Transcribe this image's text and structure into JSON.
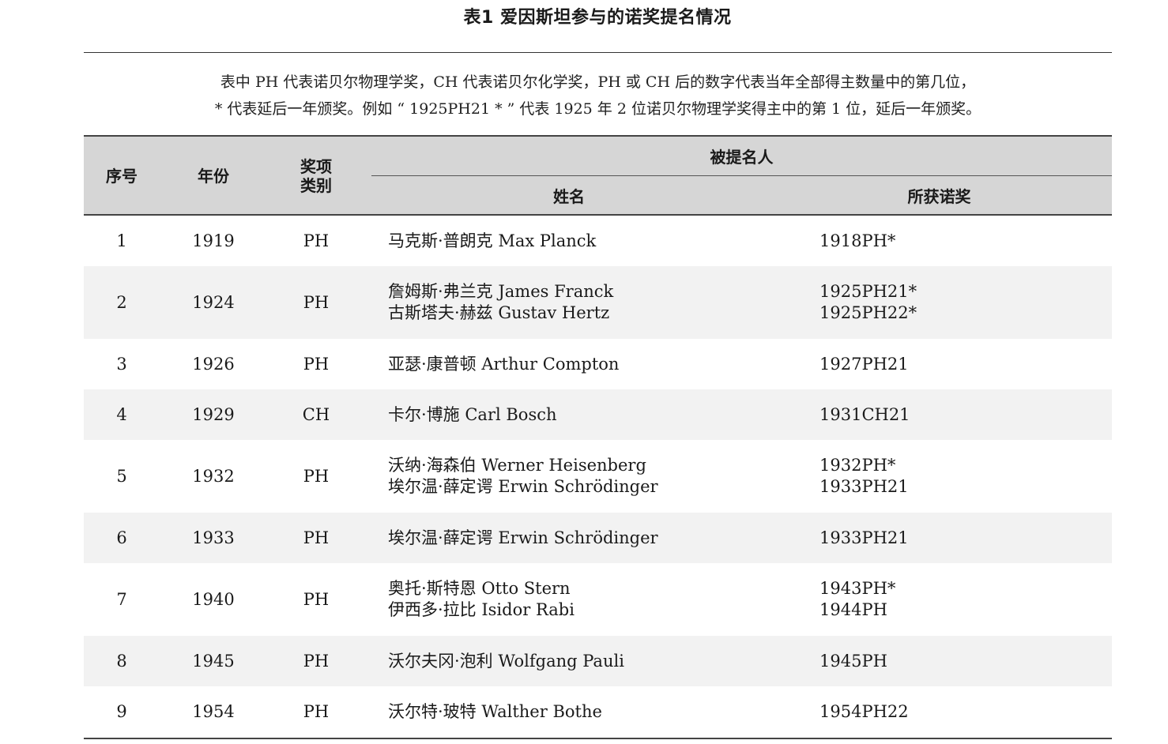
{
  "title": "表1 爱因斯坦参与的诺奖提名情况",
  "note": {
    "line1": "表中 PH 代表诺贝尔物理学奖，CH 代表诺贝尔化学奖，PH 或 CH 后的数字代表当年全部得主数量中的第几位，",
    "line2": "* 代表延后一年颁奖。例如 “ 1925PH21 * ” 代表 1925 年 2 位诺贝尔物理学奖得主中的第 1 位，延后一年颁奖。"
  },
  "headers": {
    "index": "序号",
    "year": "年份",
    "type_line1": "奖项",
    "type_line2": "类别",
    "nominee": "被提名人",
    "name": "姓名",
    "prize": "所获诺奖"
  },
  "rows": [
    {
      "index": "1",
      "year": "1919",
      "type": "PH",
      "names": [
        "马克斯·普朗克 Max Planck"
      ],
      "prizes": [
        "1918PH*"
      ]
    },
    {
      "index": "2",
      "year": "1924",
      "type": "PH",
      "names": [
        "詹姆斯·弗兰克 James Franck",
        "古斯塔夫·赫兹 Gustav Hertz"
      ],
      "prizes": [
        "1925PH21*",
        "1925PH22*"
      ]
    },
    {
      "index": "3",
      "year": "1926",
      "type": "PH",
      "names": [
        "亚瑟·康普顿 Arthur Compton"
      ],
      "prizes": [
        "1927PH21"
      ]
    },
    {
      "index": "4",
      "year": "1929",
      "type": "CH",
      "names": [
        "卡尔·博施 Carl Bosch"
      ],
      "prizes": [
        "1931CH21"
      ]
    },
    {
      "index": "5",
      "year": "1932",
      "type": "PH",
      "names": [
        "沃纳·海森伯 Werner Heisenberg",
        "埃尔温·薛定谔 Erwin Schrödinger"
      ],
      "prizes": [
        "1932PH*",
        "1933PH21"
      ]
    },
    {
      "index": "6",
      "year": "1933",
      "type": "PH",
      "names": [
        "埃尔温·薛定谔 Erwin Schrödinger"
      ],
      "prizes": [
        "1933PH21"
      ]
    },
    {
      "index": "7",
      "year": "1940",
      "type": "PH",
      "names": [
        "奥托·斯特恩 Otto Stern",
        "伊西多·拉比 Isidor Rabi"
      ],
      "prizes": [
        "1943PH*",
        "1944PH"
      ]
    },
    {
      "index": "8",
      "year": "1945",
      "type": "PH",
      "names": [
        "沃尔夫冈·泡利 Wolfgang Pauli"
      ],
      "prizes": [
        "1945PH"
      ]
    },
    {
      "index": "9",
      "year": "1954",
      "type": "PH",
      "names": [
        "沃尔特·玻特 Walther Bothe"
      ],
      "prizes": [
        "1954PH22"
      ]
    }
  ]
}
